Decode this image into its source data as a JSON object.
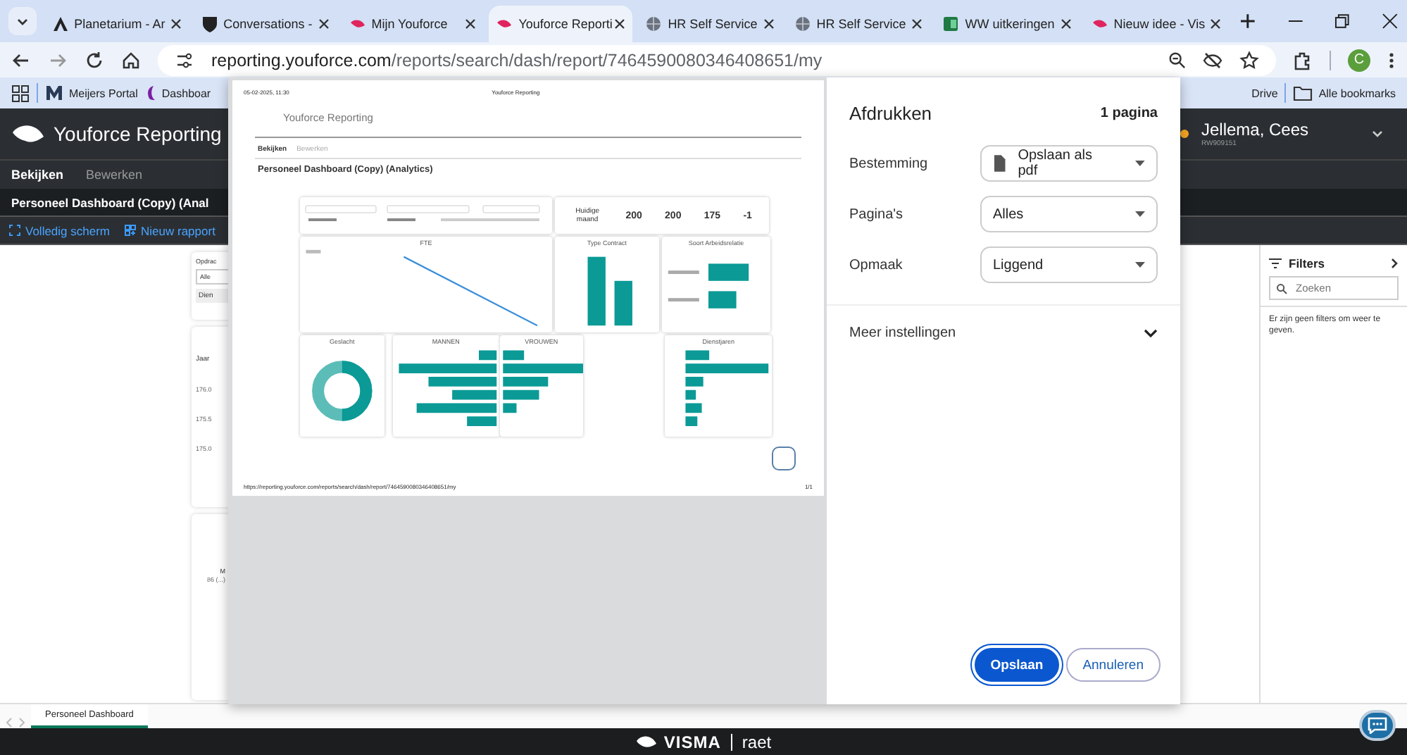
{
  "browser": {
    "tabs": [
      {
        "title": "Planetarium - Ar",
        "selected": false
      },
      {
        "title": "Conversations -",
        "selected": false
      },
      {
        "title": "Mijn Youforce",
        "selected": false
      },
      {
        "title": "Youforce Reporti",
        "selected": true
      },
      {
        "title": "HR Self Service",
        "selected": false
      },
      {
        "title": "HR Self Service",
        "selected": false
      },
      {
        "title": "WW uitkeringen",
        "selected": false
      },
      {
        "title": "Nieuw idee - Vis",
        "selected": false
      }
    ],
    "address": {
      "domain": "reporting.youforce.com",
      "path": "/reports/search/dash/report/7464590080346408651/my"
    },
    "profile": "C",
    "bookmarks": [
      {
        "label": "Meijers Portal"
      },
      {
        "label": "Dashboar"
      }
    ],
    "bookmark_partial": "Drive",
    "all_bookmarks": "Alle bookmarks"
  },
  "app": {
    "brand": "Youforce Reporting",
    "user": {
      "name": "Jellema, Cees",
      "id": "RW909151",
      "color": "#f5a623"
    },
    "menu": [
      {
        "label": "Bekijken",
        "selected": true
      },
      {
        "label": "Bewerken",
        "selected": false
      }
    ],
    "report_title": "Personeel Dashboard (Copy) (Anal",
    "toolbar": [
      {
        "label": "Volledig scherm"
      },
      {
        "label": "Nieuw rapport"
      }
    ],
    "cards": [
      {
        "items": [
          {
            "kind": "label",
            "text": "Opdrac"
          },
          {
            "kind": "field",
            "text": "Alle"
          },
          {
            "kind": "button",
            "text": "Dien"
          }
        ]
      },
      {
        "items": [
          {
            "kind": "legend",
            "text": "Jaar"
          },
          {
            "kind": "tick",
            "text": "176.0"
          },
          {
            "kind": "tick",
            "text": "175.5"
          },
          {
            "kind": "tick",
            "text": "175.0"
          }
        ]
      },
      {
        "items": [
          {
            "kind": "label",
            "text": "M"
          },
          {
            "kind": "tick",
            "text": "86 (...)"
          }
        ]
      }
    ],
    "filters": {
      "title": "Filters",
      "placeholder": "Zoeken",
      "empty": "Er zijn geen filters om weer te geven."
    },
    "sheet_tabs": [
      {
        "label": "Personeel Dashboard",
        "selected": true
      }
    ],
    "footer": {
      "brand": "VISMA",
      "product": "raet"
    }
  },
  "print_dialog": {
    "title": "Afdrukken",
    "page_count": "1 pagina",
    "settings": [
      {
        "label": "Bestemming",
        "value": "Opslaan als pdf"
      },
      {
        "label": "Pagina's",
        "value": "Alles"
      },
      {
        "label": "Opmaak",
        "value": "Liggend"
      }
    ],
    "more": "Meer instellingen",
    "expanded": false,
    "buttons": [
      {
        "label": "Opslaan",
        "primary": true
      },
      {
        "label": "Annuleren",
        "primary": false
      }
    ],
    "preview": {
      "timestamp": "05-02-2025, 11:30",
      "header_title": "Youforce Reporting",
      "brand": "Youforce Reporting",
      "menu": [
        {
          "label": "Bekijken",
          "selected": true
        },
        {
          "label": "Bewerken",
          "selected": false
        }
      ],
      "title": "Personeel Dashboard (Copy) (Analytics)",
      "kpi": {
        "label": "Huidige maand",
        "values": [
          "200",
          "200",
          "175",
          "-1"
        ]
      },
      "charts": [
        {
          "kind": "line",
          "title": "FTE"
        },
        {
          "kind": "column",
          "title": "Type Contract"
        },
        {
          "kind": "hbar",
          "title": "Soort Arbeidsrelatie"
        },
        {
          "kind": "donut",
          "title": "Geslacht"
        },
        {
          "kind": "left-bars",
          "title": "MANNEN"
        },
        {
          "kind": "right-bars",
          "title": "VROUWEN"
        },
        {
          "kind": "long-bars",
          "title": "Dienstjaren"
        }
      ],
      "url": "https://reporting.youforce.com/reports/search/dash/report/7464590080346408651/my",
      "page": "1/1"
    }
  }
}
